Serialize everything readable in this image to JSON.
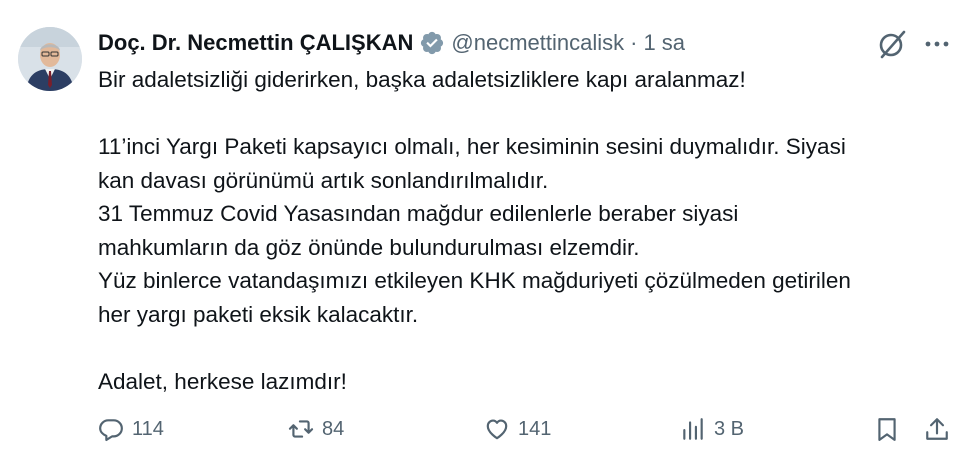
{
  "author": {
    "name": "Doç. Dr. Necmettin ÇALIŞKAN",
    "handle": "@necmettincalisk",
    "separator": "·",
    "time": "1 sa"
  },
  "post": {
    "lines": [
      "Bir adaletsizliği giderirken, başka adaletsizliklere kapı aralanmaz!",
      "",
      "11’inci Yargı Paketi kapsayıcı olmalı, her kesiminin sesini duymalıdır. Siyasi",
      "kan davası görünümü artık sonlandırılmalıdır.",
      "31 Temmuz Covid Yasasından mağdur edilenlerle beraber siyasi",
      "mahkumların da göz önünde bulundurulması elzemdir.",
      "Yüz binlerce vatandaşımızı etkileyen KHK mağduriyeti çözülmeden getirilen",
      "her yargı paketi eksik kalacaktır.",
      "",
      "Adalet, herkese lazımdır!"
    ]
  },
  "actions": {
    "replies": "114",
    "reposts": "84",
    "likes": "141",
    "views": "3 B"
  },
  "icons": {
    "verified": "verified-badge-icon",
    "grok": "grok-icon",
    "more": "more-icon",
    "reply": "reply-icon",
    "repost": "repost-icon",
    "like": "heart-icon",
    "views": "views-icon",
    "bookmark": "bookmark-icon",
    "share": "share-icon"
  },
  "colors": {
    "text": "#0f1419",
    "secondary": "#536471",
    "verified_badge": "#829aab"
  }
}
